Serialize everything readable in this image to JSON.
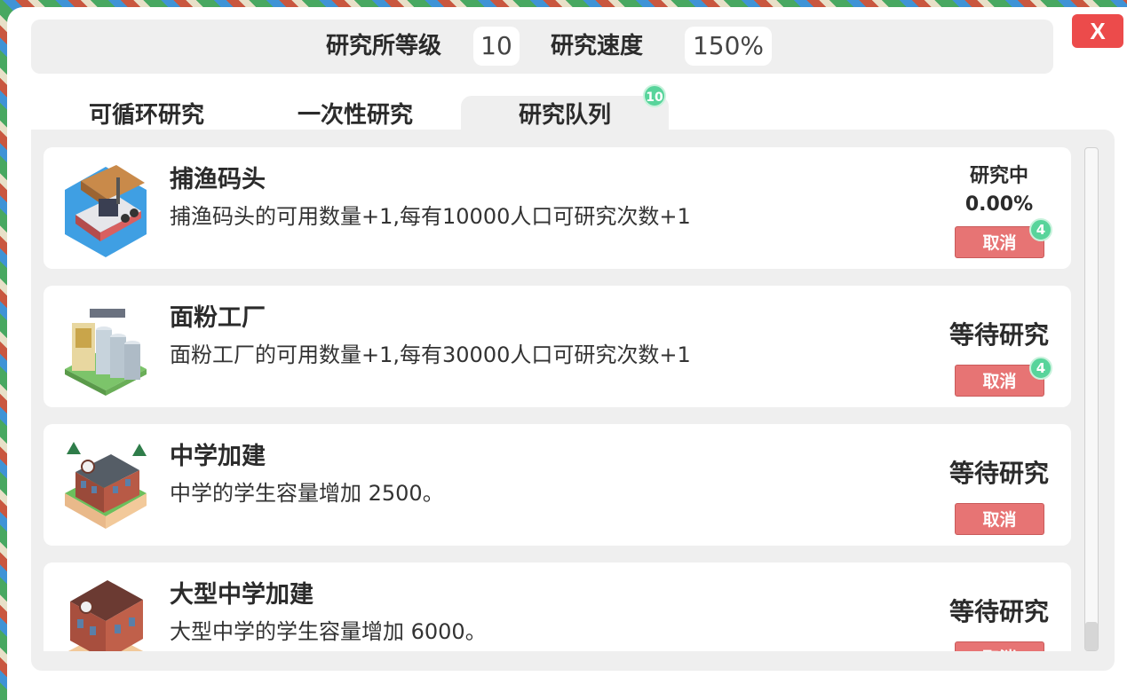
{
  "header": {
    "level_label": "研究所等级",
    "level_value": "10",
    "speed_label": "研究速度",
    "speed_value": "150%",
    "close_label": "X"
  },
  "tabs": [
    {
      "label": "可循环研究"
    },
    {
      "label": "一次性研究"
    },
    {
      "label": "研究队列",
      "badge": "10",
      "active": true
    }
  ],
  "queue": [
    {
      "title": "捕渔码头",
      "desc": "捕渔码头的可用数量+1,每有10000人口可研究次数+1",
      "status": "研究中",
      "progress": "0.00%",
      "cancel": "取消",
      "count": "4",
      "icon": "fishing-dock-icon"
    },
    {
      "title": "面粉工厂",
      "desc": "面粉工厂的可用数量+1,每有30000人口可研究次数+1",
      "status": "等待研究",
      "cancel": "取消",
      "count": "4",
      "icon": "flour-factory-icon"
    },
    {
      "title": "中学加建",
      "desc": "中学的学生容量增加 2500。",
      "status": "等待研究",
      "cancel": "取消",
      "icon": "middle-school-icon"
    },
    {
      "title": "大型中学加建",
      "desc": "大型中学的学生容量增加 6000。",
      "status": "等待研究",
      "cancel": "取消",
      "icon": "large-middle-school-icon"
    }
  ],
  "colors": {
    "close": "#ec4b4b",
    "cancel": "#e77474",
    "badge": "#58d49b"
  }
}
